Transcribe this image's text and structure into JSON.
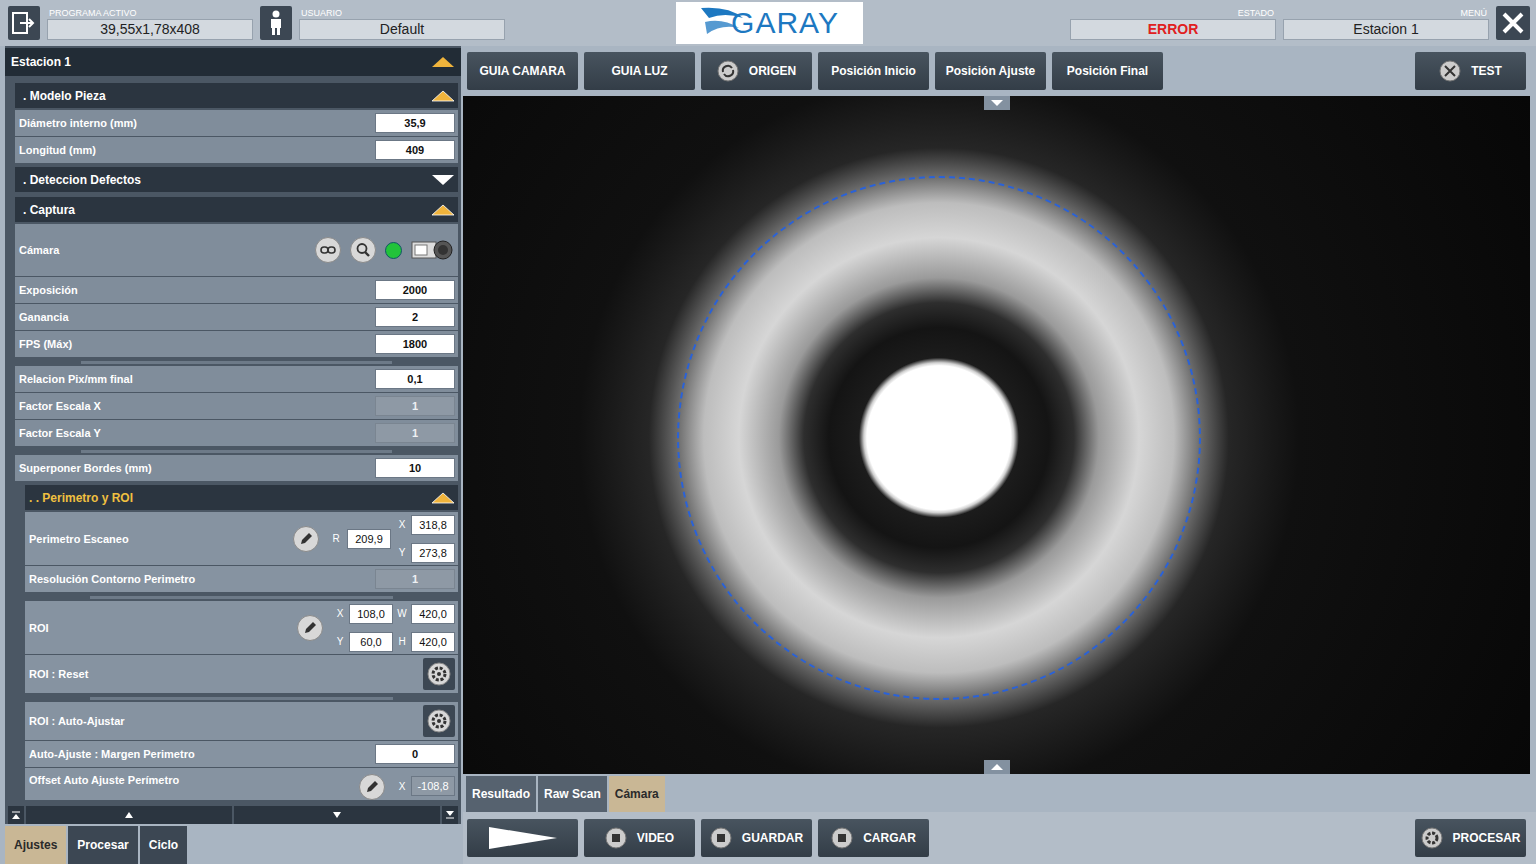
{
  "header": {
    "program_label": "PROGRAMA ACTIVO",
    "program": "39,55x1,78x408",
    "user_label": "USUARIO",
    "user": "Default",
    "logo": "GARAY",
    "status_label": "ESTADO",
    "status": "ERROR",
    "menu_label": "MENÚ",
    "menu": "Estacion 1"
  },
  "panel": {
    "title": "Estacion 1",
    "expanded": true,
    "rows": [
      {
        "kind": "section",
        "label": ". Modelo Pieza",
        "expanded": true,
        "depth": 1
      },
      {
        "kind": "field",
        "label": "Diámetro interno (mm)",
        "value": "35,9",
        "disabled": false,
        "depth": 1
      },
      {
        "kind": "field",
        "label": "Longitud (mm)",
        "value": "409",
        "disabled": false,
        "depth": 1
      },
      {
        "kind": "section",
        "label": ". Deteccion Defectos",
        "expanded": false,
        "depth": 1
      },
      {
        "kind": "section",
        "label": ". Captura",
        "expanded": true,
        "depth": 1
      },
      {
        "kind": "camera",
        "label": "Cámara",
        "connected": true,
        "color": "#22c33a",
        "depth": 1
      },
      {
        "kind": "field",
        "label": "Exposición",
        "value": "2000",
        "disabled": false,
        "depth": 1
      },
      {
        "kind": "field",
        "label": "Ganancia",
        "value": "2",
        "disabled": false,
        "depth": 1
      },
      {
        "kind": "field",
        "label": "FPS (Máx)",
        "value": "1800",
        "disabled": false,
        "depth": 1
      },
      {
        "kind": "separator",
        "depth": 1
      },
      {
        "kind": "field",
        "label": "Relacion Pix/mm final",
        "value": "0,1",
        "disabled": false,
        "depth": 1
      },
      {
        "kind": "field",
        "label": "Factor Escala X",
        "value": "1",
        "disabled": true,
        "depth": 1
      },
      {
        "kind": "field",
        "label": "Factor Escala Y",
        "value": "1",
        "disabled": true,
        "depth": 1
      },
      {
        "kind": "separator",
        "depth": 1
      },
      {
        "kind": "field",
        "label": "Superponer Bordes (mm)",
        "value": "10",
        "disabled": false,
        "depth": 1
      },
      {
        "kind": "section",
        "label": ". . Perimetro y ROI",
        "expanded": true,
        "depth": 2
      },
      {
        "kind": "perimeter",
        "label": "Perimetro Escaneo",
        "r": {
          "label": "R",
          "value": "209,9"
        },
        "coords": [
          {
            "label": "X",
            "value": "318,8"
          },
          {
            "label": "Y",
            "value": "273,8"
          }
        ],
        "depth": 2
      },
      {
        "kind": "field",
        "label": "Resolución Contorno Perimetro",
        "value": "1",
        "disabled": true,
        "depth": 2
      },
      {
        "kind": "separator",
        "depth": 2
      },
      {
        "kind": "roi",
        "label": "ROI",
        "grid": [
          [
            {
              "label": "X",
              "value": "108,0"
            },
            {
              "label": "W",
              "value": "420,0"
            }
          ],
          [
            {
              "label": "Y",
              "value": "60,0"
            },
            {
              "label": "H",
              "value": "420,0"
            }
          ]
        ],
        "depth": 2
      },
      {
        "kind": "button",
        "label": "ROI : Reset",
        "depth": 2
      },
      {
        "kind": "separator",
        "depth": 2
      },
      {
        "kind": "button",
        "label": "ROI : Auto-Ajustar",
        "depth": 2
      },
      {
        "kind": "field",
        "label": "Auto-Ajuste : Margen Perimetro",
        "value": "0",
        "disabled": false,
        "depth": 2
      },
      {
        "kind": "offset",
        "label": "Offset Auto Ajuste Perímetro",
        "coord": {
          "label": "X",
          "value": "-108,8"
        },
        "depth": 2
      }
    ]
  },
  "left_tabs": [
    {
      "label": "Ajustes",
      "selected": true
    },
    {
      "label": "Procesar",
      "selected": false
    },
    {
      "label": "Ciclo",
      "selected": false
    }
  ],
  "toolbar": [
    {
      "label": "GUIA CAMARA",
      "icon": false
    },
    {
      "label": "GUIA LUZ",
      "icon": false
    },
    {
      "label": "ORIGEN",
      "icon": true
    },
    {
      "label": "Posición Inicio",
      "icon": false
    },
    {
      "label": "Posición Ajuste",
      "icon": false
    },
    {
      "label": "Posición Final",
      "icon": false
    }
  ],
  "test_button": "TEST",
  "view_tabs": [
    {
      "label": "Resultado",
      "selected": false
    },
    {
      "label": "Raw Scan",
      "selected": false
    },
    {
      "label": "Cámara",
      "selected": true
    }
  ],
  "bottom_buttons": [
    "VIDEO",
    "GUARDAR",
    "CARGAR"
  ],
  "process_button": "PROCESAR"
}
